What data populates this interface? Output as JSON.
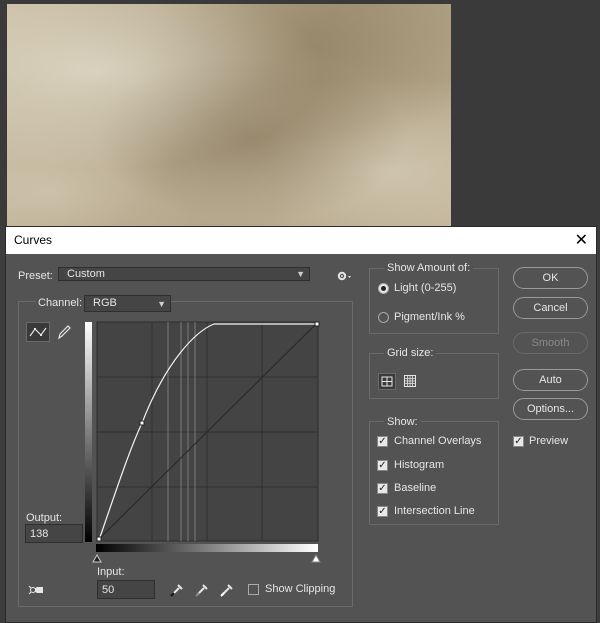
{
  "dialog": {
    "title": "Curves",
    "close": "✕"
  },
  "preset": {
    "label": "Preset:",
    "value": "Custom"
  },
  "channel": {
    "label": "Channel:",
    "value": "RGB"
  },
  "output": {
    "label": "Output:",
    "value": "138"
  },
  "input": {
    "label": "Input:",
    "value": "50"
  },
  "show_clipping": {
    "label": "Show Clipping",
    "checked": false
  },
  "show_amount": {
    "label": "Show Amount of:",
    "light": "Light  (0-255)",
    "pigment": "Pigment/Ink %",
    "selected": "light"
  },
  "grid_size": {
    "label": "Grid size:"
  },
  "show": {
    "label": "Show:",
    "options": [
      {
        "label": "Channel Overlays",
        "checked": true
      },
      {
        "label": "Histogram",
        "checked": true
      },
      {
        "label": "Baseline",
        "checked": true
      },
      {
        "label": "Intersection Line",
        "checked": true
      }
    ]
  },
  "buttons": {
    "ok": "OK",
    "cancel": "Cancel",
    "smooth": "Smooth",
    "auto": "Auto",
    "options": "Options..."
  },
  "preview": {
    "label": "Preview",
    "checked": true
  },
  "icons": {
    "gear": "gear-icon",
    "curve_tool": "curve-point-icon",
    "pencil_tool": "pencil-icon",
    "target_adjust": "targeted-adjustment-icon",
    "eyedropper_black": "eyedropper-black-icon",
    "eyedropper_gray": "eyedropper-gray-icon",
    "eyedropper_white": "eyedropper-white-icon",
    "grid_small": "grid-4-icon",
    "grid_large": "grid-10-icon"
  },
  "curve": {
    "points": [
      [
        0,
        0
      ],
      [
        50,
        138
      ],
      [
        255,
        255
      ]
    ],
    "range": [
      0,
      255
    ]
  },
  "colors": {
    "dialog_bg": "#535353",
    "graph_bg": "#444444"
  }
}
